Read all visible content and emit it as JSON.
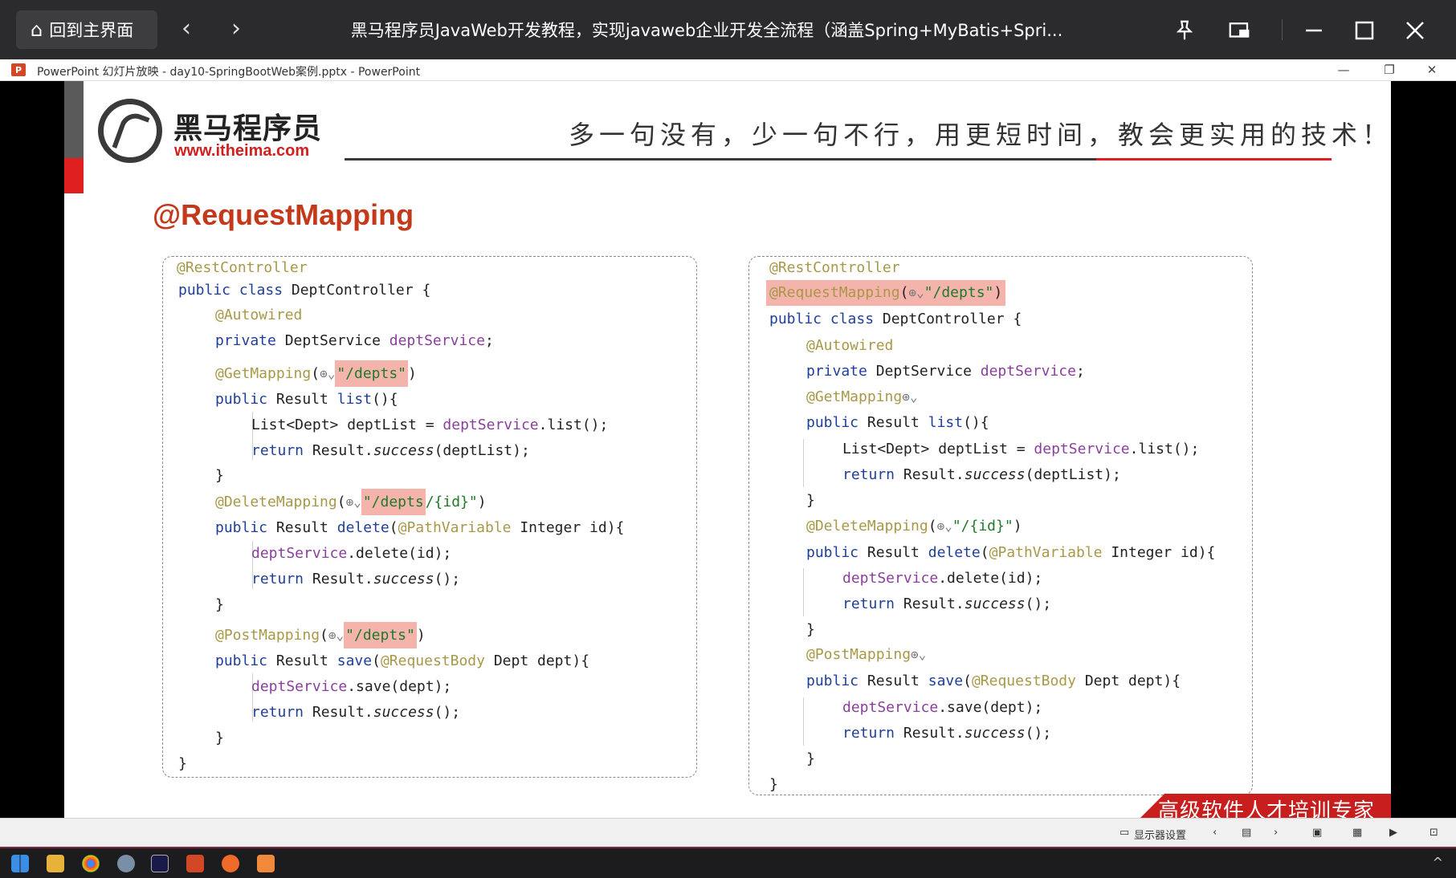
{
  "player": {
    "home_label": "回到主界面",
    "back_glyph": "‹",
    "forward_glyph": "›",
    "title": "黑马程序员JavaWeb开发教程，实现javaweb企业开发全流程（涵盖Spring+MyBatis+Spri..."
  },
  "ppt_window": {
    "logo_letter": "P",
    "title": "PowerPoint 幻灯片放映  -  day10-SpringBootWeb案例.pptx - PowerPoint"
  },
  "slide": {
    "brand_name": "黑马程序员",
    "brand_url": "www.itheima.com",
    "slogan": "多一句没有，少一句不行，用更短时间，教会更实用的技术！",
    "title": "@RequestMapping",
    "banner": "高级软件人才培训专家",
    "left_code": {
      "rest_controller": "@RestController",
      "class_decl": {
        "kw": "public class",
        "name": " DeptController {"
      },
      "autowired": "@Autowired",
      "field": {
        "kw": "private",
        "type": " DeptService ",
        "name": "deptService",
        "end": ";"
      },
      "get_mapping": {
        "ann": "@GetMapping",
        "open": "(",
        "path": "\"/depts\"",
        "close": ")"
      },
      "list_sig": {
        "kw": "public",
        "type": " Result ",
        "name": "list",
        "rest": "(){"
      },
      "list_body1": {
        "pre": "List<Dept> deptList = ",
        "field": "deptService",
        "post": ".list();"
      },
      "list_body2": {
        "kw": "return",
        "pre": " Result.",
        "it": "success",
        "post": "(deptList);"
      },
      "close1": "}",
      "delete_mapping": {
        "ann": "@DeleteMapping",
        "open": "(",
        "path": "\"/depts",
        "rest": "/{id}\"",
        "close": ")"
      },
      "delete_sig": {
        "kw": "public",
        "type": " Result ",
        "name": "delete",
        "open": "(",
        "pv": "@PathVariable",
        "rest": " Integer id){"
      },
      "delete_body1": {
        "field": "deptService",
        "post": ".delete(id);"
      },
      "delete_body2": {
        "kw": "return",
        "pre": " Result.",
        "it": "success",
        "post": "();"
      },
      "close2": "}",
      "post_mapping": {
        "ann": "@PostMapping",
        "open": "(",
        "path": "\"/depts\"",
        "close": ")"
      },
      "save_sig": {
        "kw": "public",
        "type": " Result ",
        "name": "save",
        "open": "(",
        "rb": "@RequestBody",
        "rest": " Dept dept){"
      },
      "save_body1": {
        "field": "deptService",
        "post": ".save(dept);"
      },
      "save_body2": {
        "kw": "return",
        "pre": " Result.",
        "it": "success",
        "post": "();"
      },
      "close3": "}",
      "close_class": "}"
    },
    "right_code": {
      "rest_controller": "@RestController",
      "request_mapping": {
        "ann": "@RequestMapping",
        "open": "(",
        "path": "\"/depts\"",
        "close": ")"
      },
      "class_decl": {
        "kw": "public class",
        "name": " DeptController {"
      },
      "autowired": "@Autowired",
      "field": {
        "kw": "private",
        "type": " DeptService ",
        "name": "deptService",
        "end": ";"
      },
      "get_mapping": "@GetMapping",
      "list_sig": {
        "kw": "public",
        "type": " Result ",
        "name": "list",
        "rest": "(){"
      },
      "list_body1": {
        "pre": "List<Dept> deptList = ",
        "field": "deptService",
        "post": ".list();"
      },
      "list_body2": {
        "kw": "return",
        "pre": " Result.",
        "it": "success",
        "post": "(deptList);"
      },
      "close1": "}",
      "delete_mapping": {
        "ann": "@DeleteMapping",
        "open": "(",
        "path": "\"/{id}\"",
        "close": ")"
      },
      "delete_sig": {
        "kw": "public",
        "type": " Result ",
        "name": "delete",
        "open": "(",
        "pv": "@PathVariable",
        "rest": " Integer id){"
      },
      "delete_body1": {
        "field": "deptService",
        "post": ".delete(id);"
      },
      "delete_body2": {
        "kw": "return",
        "pre": " Result.",
        "it": "success",
        "post": "();"
      },
      "close2": "}",
      "post_mapping": "@PostMapping",
      "save_sig": {
        "kw": "public",
        "type": " Result ",
        "name": "save",
        "open": "(",
        "rb": "@RequestBody",
        "rest": " Dept dept){"
      },
      "save_body1": {
        "field": "deptService",
        "post": ".save(dept);"
      },
      "save_body2": {
        "kw": "return",
        "pre": " Result.",
        "it": "success",
        "post": "();"
      },
      "close3": "}",
      "close_class": "}"
    },
    "globe_glyph": "⊕⌄"
  },
  "status_bar": {
    "display_settings": "显示器设置"
  },
  "colors": {
    "accent_red": "#e02020",
    "title_red": "#c4391b",
    "highlight": "#f4b4ab",
    "annotation": "#a89848",
    "keyword": "#1f3f9a",
    "field": "#8a3f9e"
  }
}
